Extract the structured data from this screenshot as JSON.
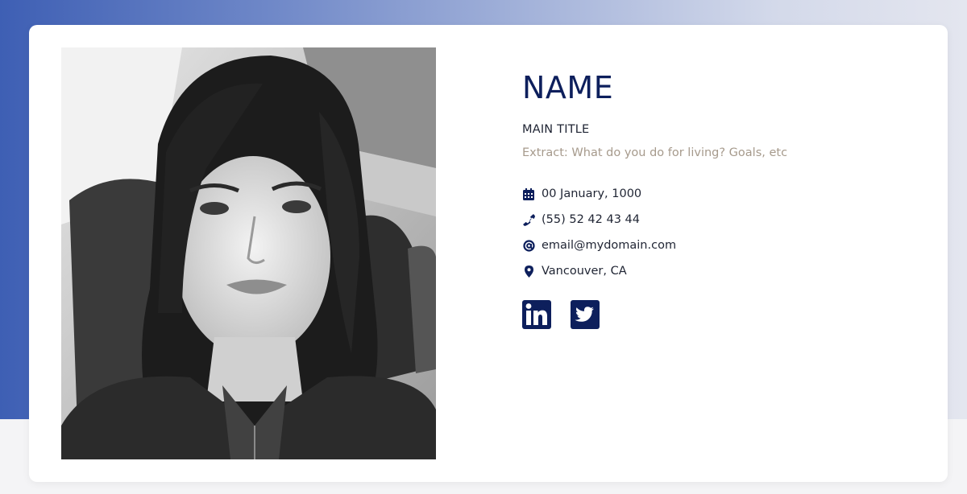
{
  "profile": {
    "name": "NAME",
    "main_title": "MAIN TITLE",
    "extract": "Extract: What do you do for living? Goals, etc"
  },
  "details": [
    {
      "icon": "calendar-icon",
      "text": "00 January, 1000"
    },
    {
      "icon": "phone-icon",
      "text": "(55) 52 42 43 44"
    },
    {
      "icon": "at-sign-icon",
      "text": "email@mydomain.com"
    },
    {
      "icon": "map-pin-icon",
      "text": "Vancouver, CA"
    }
  ],
  "socials": [
    {
      "icon": "linkedin-icon"
    },
    {
      "icon": "twitter-icon"
    }
  ],
  "colors": {
    "accent": "#0d1f5c",
    "muted": "#a69a8c",
    "band_start": "#3e5fb4",
    "band_end": "#e4e6ef"
  }
}
